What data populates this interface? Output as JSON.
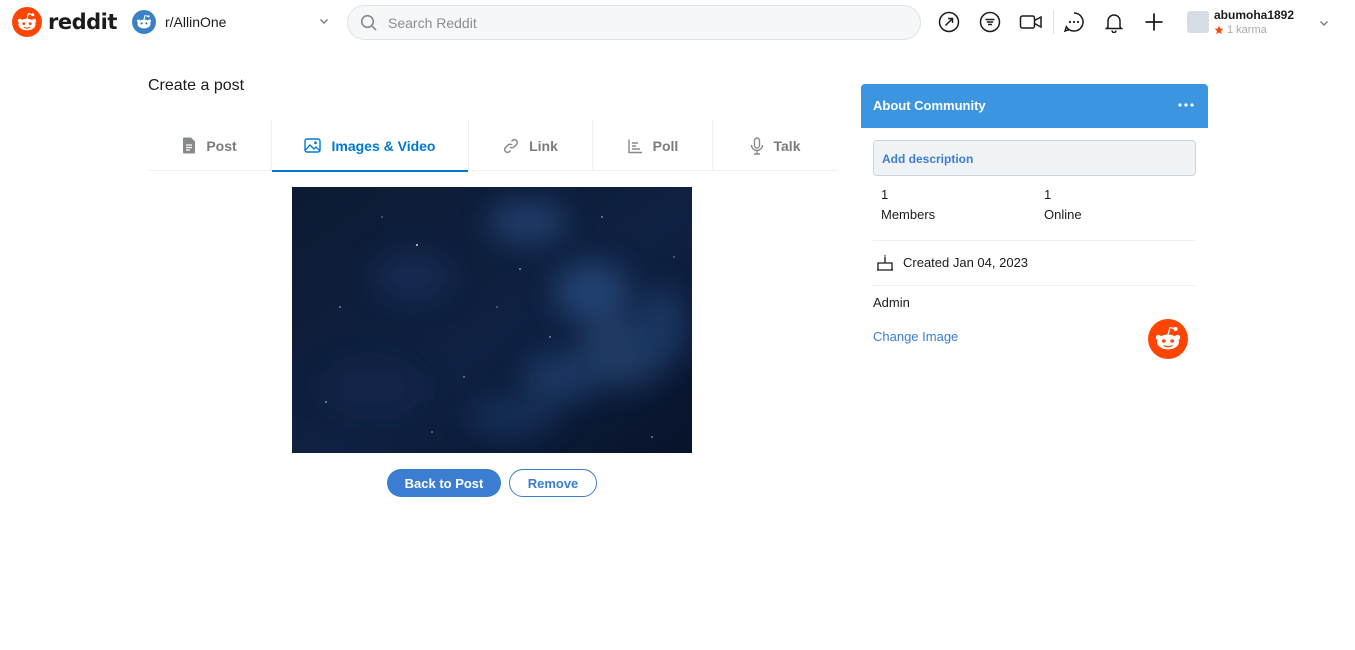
{
  "header": {
    "logo_text": "reddit",
    "community": "r/AllinOne",
    "search_placeholder": "Search Reddit",
    "icons": [
      "popular-icon",
      "all-icon",
      "video-icon",
      "chat-icon",
      "notification-icon",
      "create-post-icon"
    ],
    "user": {
      "name": "abumoha1892",
      "karma": "1 karma"
    }
  },
  "main": {
    "title": "Create a post",
    "tabs": [
      {
        "label": "Post",
        "icon": "document-icon"
      },
      {
        "label": "Images & Video",
        "icon": "image-icon",
        "active": true
      },
      {
        "label": "Link",
        "icon": "link-icon"
      },
      {
        "label": "Poll",
        "icon": "poll-icon"
      },
      {
        "label": "Talk",
        "icon": "microphone-icon"
      }
    ],
    "buttons": {
      "back": "Back to Post",
      "remove": "Remove"
    }
  },
  "sidebar": {
    "title": "About Community",
    "add_description": "Add description",
    "members": {
      "count": "1",
      "label": "Members"
    },
    "online": {
      "count": "1",
      "label": "Online"
    },
    "created": "Created Jan 04, 2023",
    "admin": "Admin",
    "change_image": "Change Image"
  },
  "colors": {
    "brand": "#ff4500",
    "accent": "#0079d3",
    "button_blue": "#3b7ed1",
    "sidebar_header": "#3b95e0"
  }
}
